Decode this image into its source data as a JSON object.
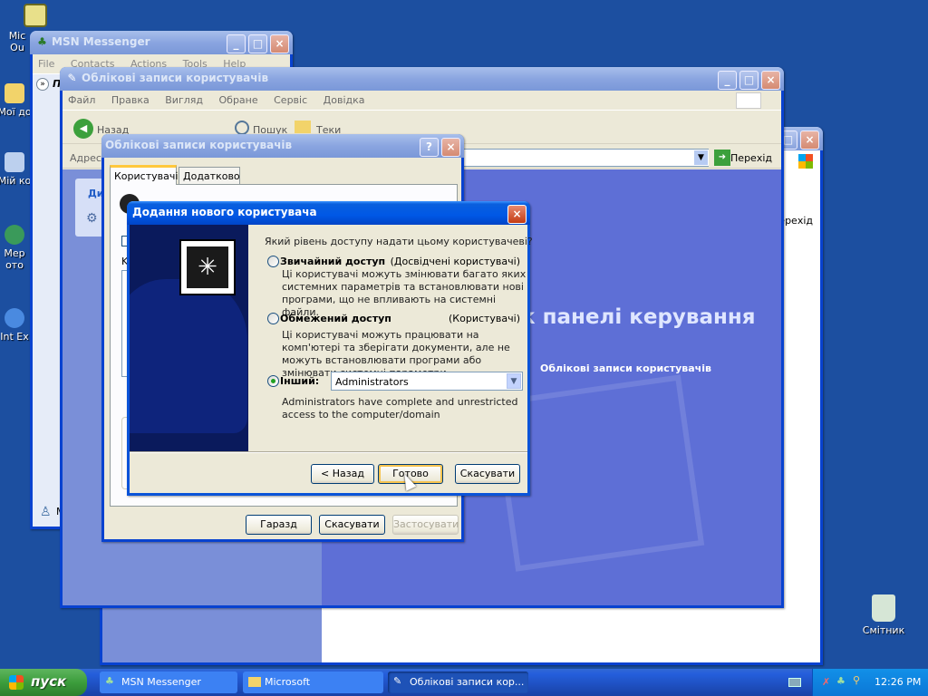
{
  "desktop": {
    "icons": [
      {
        "label": "Mic Ou"
      },
      {
        "label": "Мої до"
      },
      {
        "label": "Мій ко"
      },
      {
        "label": "Мер ото"
      },
      {
        "label": "Int Ex"
      },
      {
        "label": "Смітник"
      }
    ]
  },
  "msn": {
    "title": "MSN Messenger",
    "menu": [
      "File",
      "Contacts",
      "Actions",
      "Tools",
      "Help"
    ],
    "sidebar_head": "П",
    "bottom_label": "M"
  },
  "cp": {
    "title": "Облікові записи користувачів",
    "menu": [
      "Файл",
      "Правка",
      "Вигляд",
      "Обране",
      "Сервіс",
      "Довідка"
    ],
    "back": "Назад",
    "search": "Пошук",
    "folders": "Теки",
    "address_label": "Адреса",
    "go": "Перехід",
    "panel_title": "к панелі керування",
    "panel_link": "Облікові записи користувачів",
    "side_head": "Ди",
    "right_go": "ерехід",
    "dots": "..."
  },
  "ua": {
    "title": "Облікові записи користувачів",
    "tabs": [
      "Користувачі",
      "Додатково"
    ],
    "ok": "Гаразд",
    "cancel": "Скасувати",
    "apply": "Застосувати",
    "left_letters": [
      "K",
      "F",
      "S"
    ]
  },
  "wizard": {
    "title": "Додання нового користувача",
    "question": "Який рівень доступу надати цьому користувачеві?",
    "options": [
      {
        "label": "Звичайний доступ",
        "group": "(Досвідчені користувачі)",
        "desc": "Ці користувачі можуть змінювати багато яких системних параметрів та встановлювати нові програми, що не впливають на системні файли.",
        "selected": false
      },
      {
        "label": "Обмежений доступ",
        "group": "(Користувачі)",
        "desc": "Ці користувачі можуть працювати на комп'ютері та зберігати документи, але не можуть встановлювати програми або змінювати системні параметри.",
        "selected": false
      },
      {
        "label": "Інший:",
        "group": "",
        "desc": "Administrators have complete and unrestricted access to the computer/domain",
        "selected": true
      }
    ],
    "other_value": "Administrators",
    "back": "< Назад",
    "finish": "Готово",
    "cancel": "Скасувати"
  },
  "taskbar": {
    "start": "пуск",
    "tasks": [
      "MSN Messenger",
      "Microsoft",
      "Облікові записи кор..."
    ],
    "clock": "12:26 PM"
  },
  "colors": {
    "desktop": "#1c4fa0",
    "titlebar": "#0058e6",
    "start": "#3c9d3c",
    "wizard_panel": "#0a1a5c"
  }
}
